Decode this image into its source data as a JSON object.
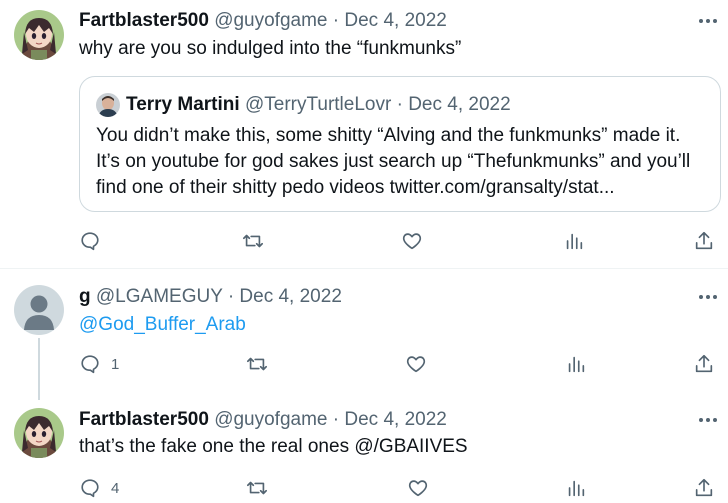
{
  "tweet1": {
    "name": "Fartblaster500",
    "handle": "@guyofgame",
    "dot": "·",
    "date": "Dec 4, 2022",
    "text": "why are you so indulged into the “funkmunks”",
    "quote": {
      "name": "Terry Martini",
      "handle": "@TerryTurtleLovr",
      "dot": "·",
      "date": "Dec 4, 2022",
      "lines": [
        "You didn’t make this, some shitty “Alving and the funkmunks” made it.",
        "It’s on youtube for god sakes just search up “Thefunkmunks” and you’ll",
        "find one of their shitty pedo videos twitter.com/gransalty/stat..."
      ]
    },
    "reply_count": "",
    "retweet_count": "",
    "like_count": ""
  },
  "tweet2": {
    "name": "g",
    "handle": "@LGAMEGUY",
    "dot": "·",
    "date": "Dec 4, 2022",
    "mention": "@God_Buffer_Arab",
    "reply_count": "1",
    "retweet_count": "",
    "like_count": ""
  },
  "tweet3": {
    "name": "Fartblaster500",
    "handle": "@guyofgame",
    "dot": "·",
    "date": "Dec 4, 2022",
    "text": "that’s the fake one the real ones @/GBAIIVES",
    "reply_count": "4",
    "retweet_count": "",
    "like_count": ""
  },
  "colors": {
    "text": "#0f1419",
    "secondary": "#536471",
    "link": "#1d9bf0",
    "border": "#cfd9de"
  }
}
